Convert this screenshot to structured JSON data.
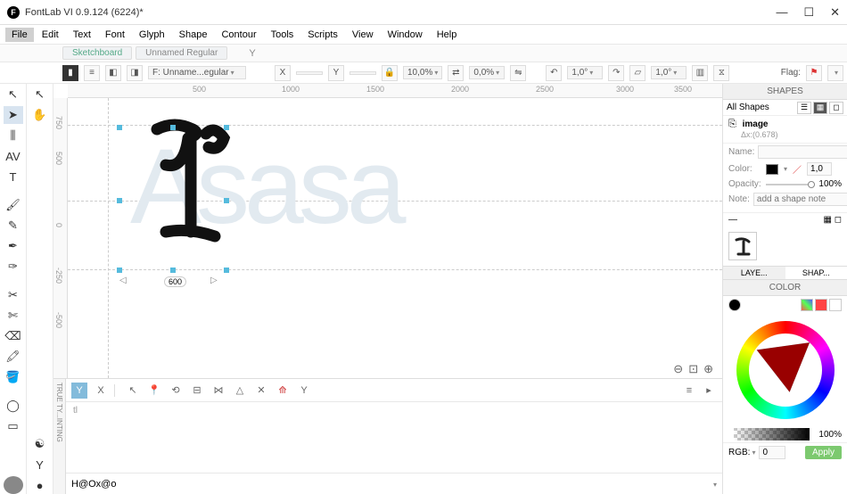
{
  "window": {
    "title": "FontLab VI 0.9.124 (6224)*"
  },
  "menu": [
    "File",
    "Edit",
    "Text",
    "Font",
    "Glyph",
    "Shape",
    "Contour",
    "Tools",
    "Scripts",
    "View",
    "Window",
    "Help"
  ],
  "tabs": [
    {
      "label": "Sketchboard",
      "active": true
    },
    {
      "label": "Unnamed Regular",
      "active": false
    }
  ],
  "toolbar": {
    "font_field": "F: Unname...egular",
    "x_val": "",
    "y_val": "",
    "pct1": "10,0%",
    "pct2": "0,0%",
    "val1": "1,0°",
    "val2": "1,0°",
    "flag": "Flag:"
  },
  "ruler_h": [
    "500",
    "1000",
    "1500",
    "2000",
    "2500",
    "3000",
    "3500"
  ],
  "ruler_v": [
    "750",
    "500",
    "0",
    "-250",
    "-500"
  ],
  "bg_text": "Asasa",
  "glyph_width": "600",
  "bottom": {
    "label": "TRUE TY...INTING",
    "text": "H@Ox@o",
    "tl": "tl"
  },
  "shapes": {
    "title": "SHAPES",
    "all": "All Shapes",
    "item": "image",
    "item_sub": "Δx:(0.678)",
    "name_lbl": "Name:",
    "name_val": "",
    "color_lbl": "Color:",
    "color_val": "1,0",
    "opacity_lbl": "Opacity:",
    "opacity_val": "100%",
    "note_lbl": "Note:",
    "note_ph": "add a shape note"
  },
  "layers_tab": "LAYE...",
  "shapes_tab": "SHAP...",
  "color": {
    "title": "COLOR",
    "alpha": "100%",
    "mode": "RGB:",
    "val": "0",
    "apply": "Apply"
  }
}
